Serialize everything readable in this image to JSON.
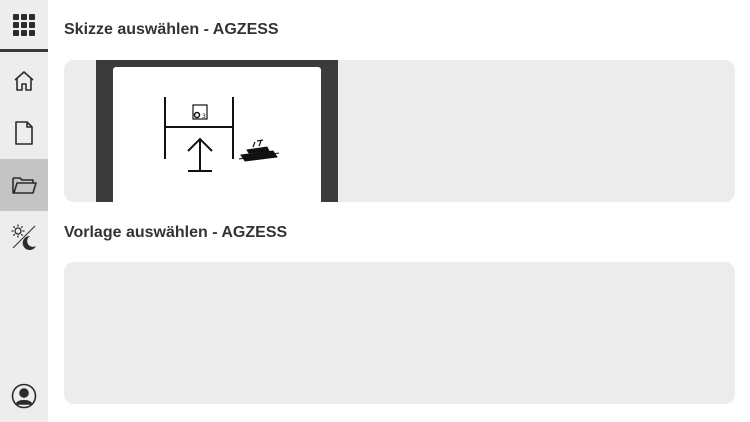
{
  "sections": {
    "sketch": {
      "title": "Skizze auswählen - AGZESS"
    },
    "template": {
      "title": "Vorlage auswählen - AGZESS"
    }
  },
  "sidebar": {
    "items": [
      {
        "icon": "apps-grid-icon"
      },
      {
        "icon": "home-icon"
      },
      {
        "icon": "document-icon"
      },
      {
        "icon": "folder-icon",
        "active": true
      },
      {
        "icon": "theme-toggle-icon"
      },
      {
        "icon": "user-account-icon"
      }
    ]
  },
  "colors": {
    "sidebar_bg": "#ededed",
    "active_item_bg": "#c4c4c4",
    "panel_bg": "#ececec",
    "card_frame": "#3b3b3b",
    "text": "#333333"
  }
}
